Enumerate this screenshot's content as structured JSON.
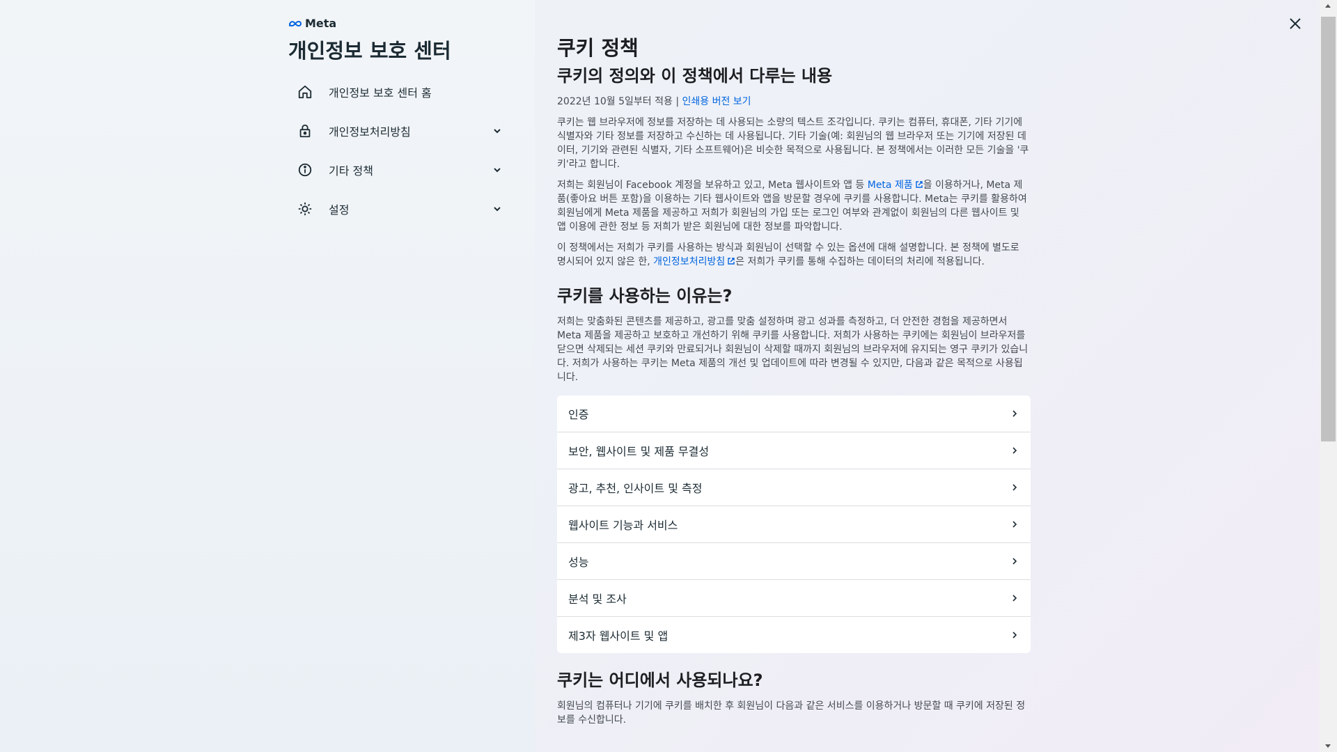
{
  "brand": {
    "name": "Meta"
  },
  "sidebar": {
    "title": "개인정보 보호 센터",
    "items": [
      {
        "label": "개인정보 보호 센터 홈",
        "icon": "home-icon"
      },
      {
        "label": "개인정보처리방침",
        "icon": "lock-icon"
      },
      {
        "label": "기타 정책",
        "icon": "info-icon"
      },
      {
        "label": "설정",
        "icon": "gear-icon"
      }
    ]
  },
  "content": {
    "title": "쿠키 정책",
    "subtitle": "쿠키의 정의와 이 정책에서 다루는 내용",
    "effective_date": "2022년 10월 5일부터 적용",
    "separator": "|",
    "print_link": "인쇄용 버전 보기",
    "para1": "쿠키는 웹 브라우저에 정보를 저장하는 데 사용되는 소량의 텍스트 조각입니다. 쿠키는 컴퓨터, 휴대폰, 기타 기기에 식별자와 기타 정보를 저장하고 수신하는 데 사용됩니다. 기타 기술(예: 회원님의 웹 브라우저 또는 기기에 저장된 데이터, 기기와 관련된 식별자, 기타 소프트웨어)은 비슷한 목적으로 사용됩니다. 본 정책에서는 이러한 모든 기술을 '쿠키'라고 합니다.",
    "para2_a": "저희는 회원님이 Facebook 계정을 보유하고 있고, Meta 웹사이트와 앱 등 ",
    "para2_link": "Meta 제품",
    "para2_b": "을 이용하거나, Meta 제품(좋아요 버튼 포함)을 이용하는 기타 웹사이트와 앱을 방문할 경우에 쿠키를 사용합니다. Meta는 쿠키를 활용하여 회원님에게 Meta 제품을 제공하고 저희가 회원님의 가입 또는 로그인 여부와 관계없이 회원님의 다른 웹사이트 및 앱 이용에 관한 정보 등 저희가 받은 회원님에 대한 정보를 파악합니다.",
    "para3_a": "이 정책에서는 저희가 쿠키를 사용하는 방식과 회원님이 선택할 수 있는 옵션에 대해 설명합니다. 본 정책에 별도로 명시되어 있지 않은 한, ",
    "para3_link": "개인정보처리방침",
    "para3_b": "은 저희가 쿠키를 통해 수집하는 데이터의 처리에 적용됩니다.",
    "section1_title": "쿠키를 사용하는 이유는?",
    "section1_para": "저희는 맞춤화된 콘텐츠를 제공하고, 광고를 맞춤 설정하며 광고 성과를 측정하고, 더 안전한 경험을 제공하면서 Meta 제품을 제공하고 보호하고 개선하기 위해 쿠키를 사용합니다. 저희가 사용하는 쿠키에는 회원님이 브라우저를 닫으면 삭제되는 세션 쿠키와 만료되거나 회원님이 삭제할 때까지 회원님의 브라우저에 유지되는 영구 쿠키가 있습니다. 저희가 사용하는 쿠키는 Meta 제품의 개선 및 업데이트에 따라 변경될 수 있지만, 다음과 같은 목적으로 사용됩니다.",
    "accordion": [
      "인증",
      "보안, 웹사이트 및 제품 무결성",
      "광고, 추천, 인사이트 및 측정",
      "웹사이트 기능과 서비스",
      "성능",
      "분석 및 조사",
      "제3자 웹사이트 및 앱"
    ],
    "section2_title": "쿠키는 어디에서 사용되나요?",
    "section2_para": "회원님의 컴퓨터나 기기에 쿠키를 배치한 후 회원님이 다음과 같은 서비스를 이용하거나 방문할 때 쿠키에 저장된 정보를 수신합니다."
  }
}
